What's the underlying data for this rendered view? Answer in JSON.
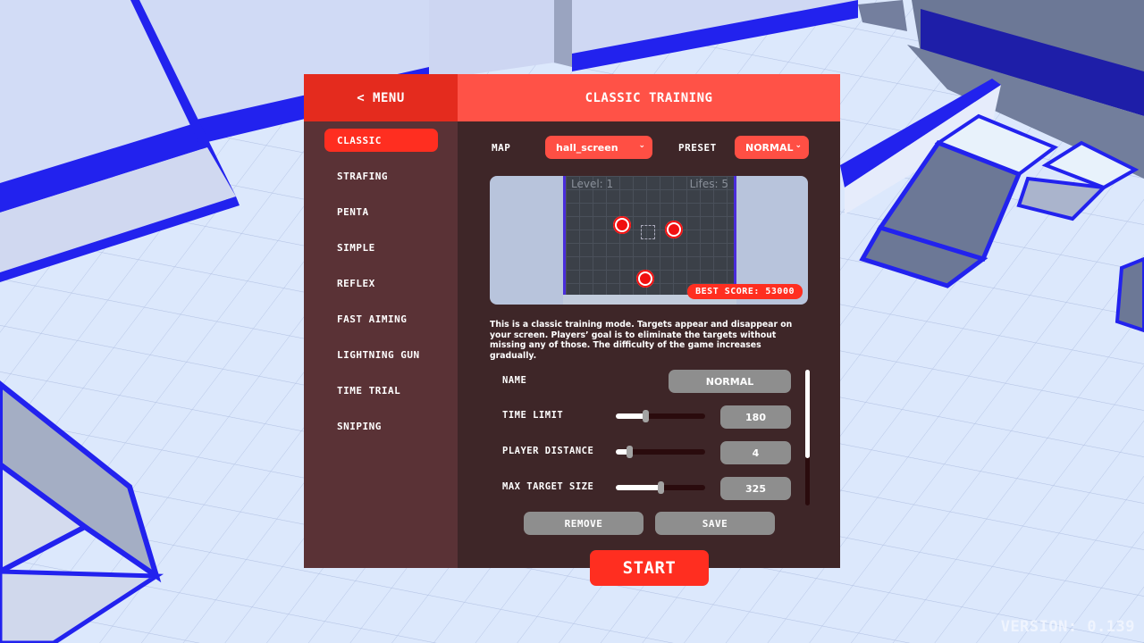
{
  "header": {
    "menu_label": "< MENU",
    "title": "CLASSIC TRAINING"
  },
  "sidebar": {
    "items": [
      {
        "label": "CLASSIC",
        "active": true
      },
      {
        "label": "STRAFING"
      },
      {
        "label": "PENTA"
      },
      {
        "label": "SIMPLE"
      },
      {
        "label": "REFLEX"
      },
      {
        "label": "FAST AIMING"
      },
      {
        "label": "LIGHTNING GUN"
      },
      {
        "label": "TIME TRIAL"
      },
      {
        "label": "SNIPING"
      }
    ]
  },
  "controls": {
    "map_label": "MAP",
    "map_value": "hall_screen",
    "preset_label": "PRESET",
    "preset_value": "NORMAL"
  },
  "preview": {
    "level_text": "Level: 1",
    "lifes_text": "Lifes: 5",
    "best_score_text": "BEST SCORE: 53000"
  },
  "description": "This is a classic training mode. Targets appear and disappear on your screen. Players’ goal is to eliminate the targets without missing any of those. The difficulty of the game increases gradually.",
  "settings": {
    "name_label": "NAME",
    "name_value": "NORMAL",
    "rows": [
      {
        "label": "TIME LIMIT",
        "value": "180",
        "slider_fraction": 0.33
      },
      {
        "label": "PLAYER DISTANCE",
        "value": "4",
        "slider_fraction": 0.15
      },
      {
        "label": "MAX TARGET SIZE",
        "value": "325",
        "slider_fraction": 0.5
      }
    ],
    "scroll_fraction_visible": 0.65
  },
  "buttons": {
    "remove": "REMOVE",
    "save": "SAVE",
    "start": "START"
  },
  "footer": {
    "version_text": "VERSION:  0.139"
  },
  "colors": {
    "accent_red": "#ff2e20",
    "header_red": "#ff5247",
    "menu_red": "#e42b1e",
    "sidebar_bg": "#5a3236",
    "content_bg": "#3e2628",
    "scene_blue": "#2222ee"
  }
}
